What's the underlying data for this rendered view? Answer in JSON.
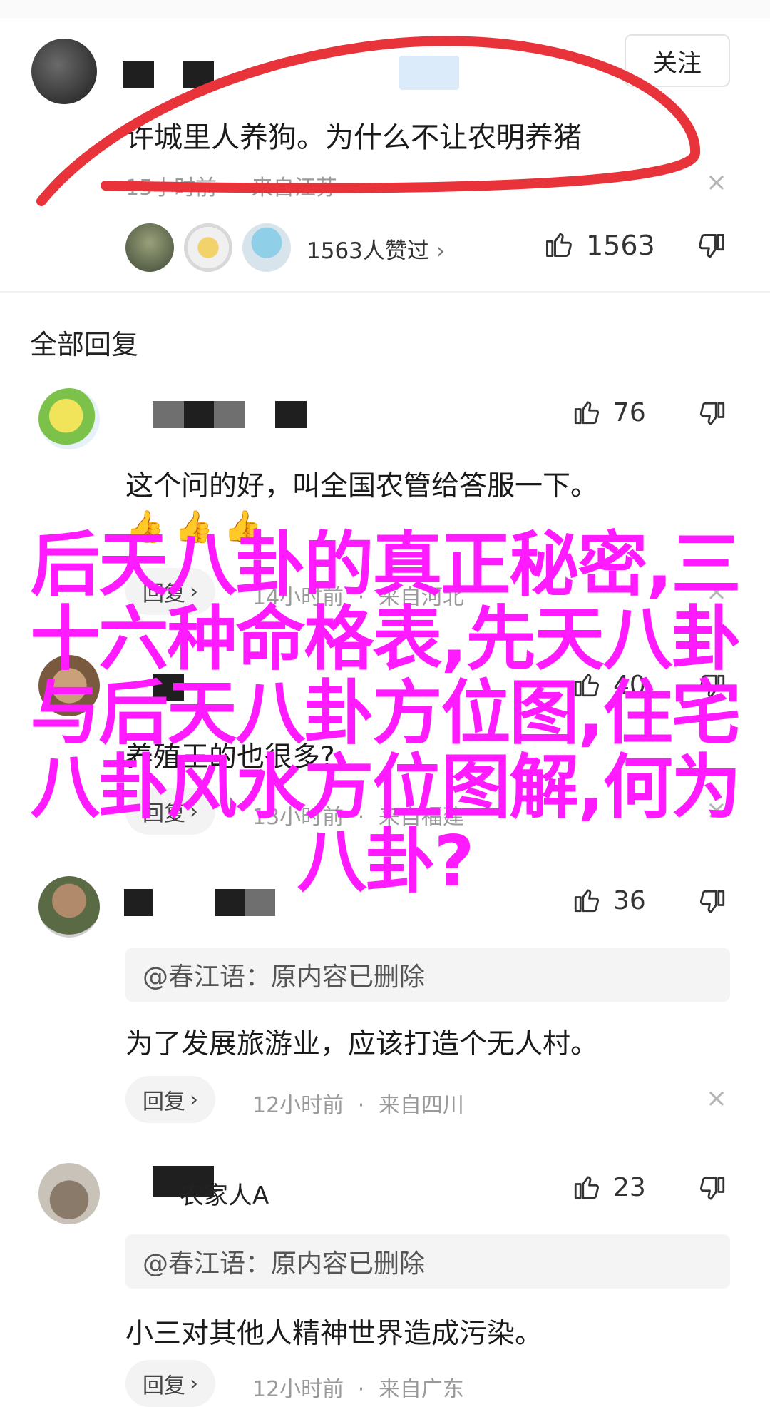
{
  "post": {
    "follow_label": "关注",
    "text": "许城里人养狗。为什么不让农明养猪",
    "time": "15小时前",
    "sep": "·",
    "location": "来自江苏",
    "likers_summary": "1563人赞过",
    "likes": "1563",
    "close": "×"
  },
  "section_title": "全部回复",
  "comments": [
    {
      "likes": "76",
      "text": "这个问的好，叫全国农管给答服一下。",
      "emojis": "👍 👍 👍",
      "reply_label": "回复",
      "time": "14小时前",
      "location": "来自河北"
    },
    {
      "likes": "40",
      "text": "养殖王的也很多?",
      "reply_label": "回复",
      "time": "13小时前",
      "location": "来自福建"
    },
    {
      "likes": "36",
      "quote": "@春江语：原内容已删除",
      "text": "为了发展旅游业，应该打造个无人村。",
      "reply_label": "回复",
      "time": "12小时前",
      "location": "来自四川"
    },
    {
      "username": "农家人A",
      "likes": "23",
      "quote": "@春江语：原内容已删除",
      "text": "小三对其他人精神世界造成污染。",
      "reply_label": "回复",
      "time": "12小时前",
      "location": "来自广东"
    }
  ],
  "overlay_title": "后天八卦的真正秘密,三十六种命格表,先天八卦与后天八卦方位图,住宅八卦风水方位图解,何为八卦?",
  "colors": {
    "annotation_stroke": "#e8333a",
    "overlay_text": "#ff1aff",
    "meta_text": "#9a9a9a"
  },
  "icons": {
    "like": "thumbs-up-icon",
    "dislike": "thumbs-down-icon",
    "close": "close-icon",
    "chevron": "chevron-right-icon"
  }
}
